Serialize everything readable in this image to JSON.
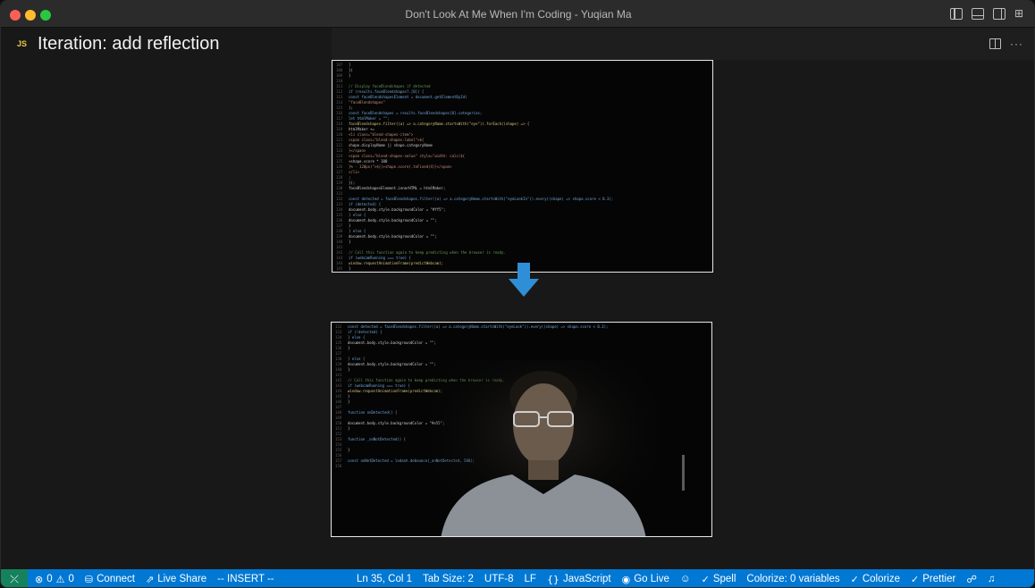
{
  "window": {
    "title": "Don't Look At Me When I'm Coding - Yuqian Ma"
  },
  "tab": {
    "file_badge": "JS",
    "title": "Iteration: add reflection"
  },
  "status_bar": {
    "errors": "0",
    "warnings": "0",
    "connect": "Connect",
    "live_share": "Live Share",
    "mode": "-- INSERT --",
    "cursor": "Ln 35, Col 1",
    "tab_size": "Tab Size: 2",
    "encoding": "UTF-8",
    "eol": "LF",
    "language": "JavaScript",
    "go_live": "Go Live",
    "spell": "Spell",
    "colorize_vars": "Colorize: 0 variables",
    "colorize": "Colorize",
    "prettier": "Prettier"
  },
  "colors": {
    "accent": "#0078d4",
    "remote": "#16825d",
    "arrow": "#2f8fd6"
  },
  "icons": [
    "layout-left-icon",
    "layout-bottom-icon",
    "layout-right-icon",
    "customize-layout-icon",
    "split-editor-icon",
    "more-actions-icon",
    "remote-icon",
    "error-icon",
    "warning-icon",
    "database-icon",
    "live-share-icon",
    "braces-icon",
    "broadcast-icon",
    "copilot-icon",
    "check-icon",
    "feedback-icon",
    "bell-icon",
    "down-arrow-icon"
  ]
}
